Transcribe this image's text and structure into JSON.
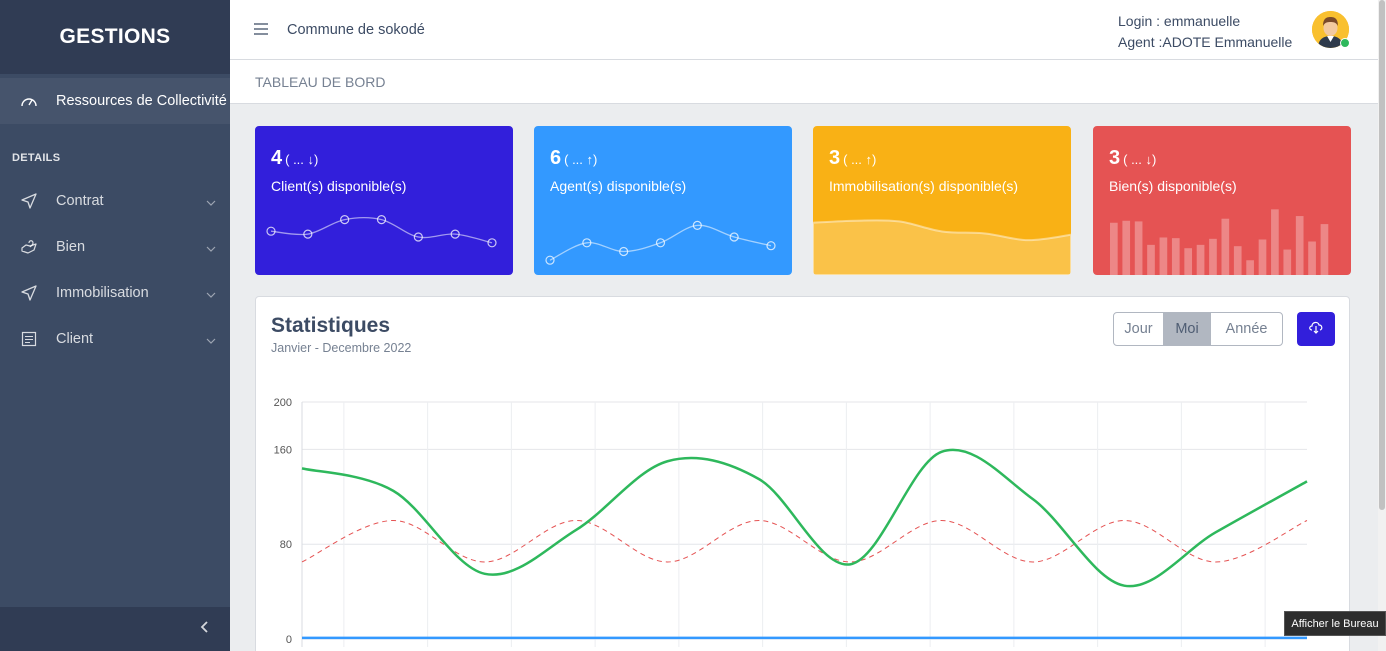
{
  "sidebar": {
    "brand": "GESTIONS",
    "active_item": "Ressources de Collectivité",
    "section_title": "DETAILS",
    "items": [
      {
        "label": "Contrat",
        "icon": "send-icon"
      },
      {
        "label": "Bien",
        "icon": "heart-hand-icon"
      },
      {
        "label": "Immobilisation",
        "icon": "send-icon"
      },
      {
        "label": "Client",
        "icon": "list-icon"
      }
    ]
  },
  "header": {
    "commune": "Commune de sokodé",
    "login_line": "Login : emmanuelle",
    "agent_line": "Agent :ADOTE Emmanuelle"
  },
  "breadcrumb": "TABLEAU DE BORD",
  "widgets": [
    {
      "value": "4",
      "trend": "( ... ↓)",
      "label": "Client(s) disponible(s)",
      "color": "#321fdb",
      "spark": [
        60,
        55,
        80,
        80,
        50,
        55,
        40
      ]
    },
    {
      "value": "6",
      "trend": "( ... ↑)",
      "label": "Agent(s) disponible(s)",
      "color": "#3399ff",
      "spark": [
        10,
        40,
        25,
        40,
        70,
        50,
        35
      ]
    },
    {
      "value": "3",
      "trend": "( ... ↑)",
      "label": "Immobilisation(s) disponible(s)",
      "color": "#f9b115",
      "spark": [
        78,
        81,
        80,
        65,
        62,
        52,
        60
      ]
    },
    {
      "value": "3",
      "trend": "( ... ↓)",
      "label": "Bien(s) disponible(s)",
      "color": "#e55353",
      "spark": [
        78,
        81,
        80,
        45,
        56,
        55,
        40,
        45,
        54,
        84,
        43,
        22,
        53,
        98,
        38,
        88,
        50,
        76
      ]
    }
  ],
  "stats": {
    "title": "Statistiques",
    "subtitle": "Janvier - Decembre 2022",
    "buttons": [
      "Jour",
      "Moi",
      "Année"
    ],
    "selected": "Moi"
  },
  "chart_data": {
    "type": "line",
    "ylim": [
      0,
      200
    ],
    "y_ticks": [
      "0",
      "80",
      "160",
      "200"
    ],
    "grid": true,
    "series": [
      {
        "color": "#2eb85c",
        "style": "solid",
        "values": [
          144,
          125,
          55,
          92,
          150,
          135,
          63,
          158,
          118,
          45,
          90,
          133
        ]
      },
      {
        "color": "#e55353",
        "style": "dashed",
        "values": [
          65,
          100,
          65,
          100,
          65,
          100,
          65,
          100,
          65,
          100,
          65,
          100
        ]
      },
      {
        "color": "#39f",
        "style": "solid",
        "values": [
          1,
          1,
          1,
          1,
          1,
          1,
          1,
          1,
          1,
          1,
          1,
          1
        ]
      }
    ]
  },
  "tooltip": "Afficher le Bureau"
}
